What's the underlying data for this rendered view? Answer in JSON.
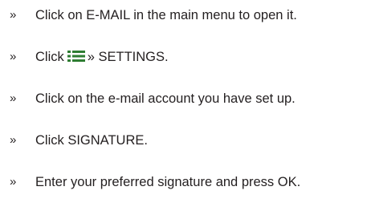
{
  "marker": "»",
  "steps": [
    {
      "text": "Click on E-MAIL in the main menu to open it."
    },
    {
      "before": "Click",
      "icon": "menu-icon",
      "after": "» SETTINGS."
    },
    {
      "text": "Click on the e-mail account you have set up."
    },
    {
      "text": "Click SIGNATURE."
    },
    {
      "text": "Enter your preferred signature and press OK."
    }
  ],
  "colors": {
    "text": "#231f20",
    "icon_fill": "#2e7d32"
  }
}
